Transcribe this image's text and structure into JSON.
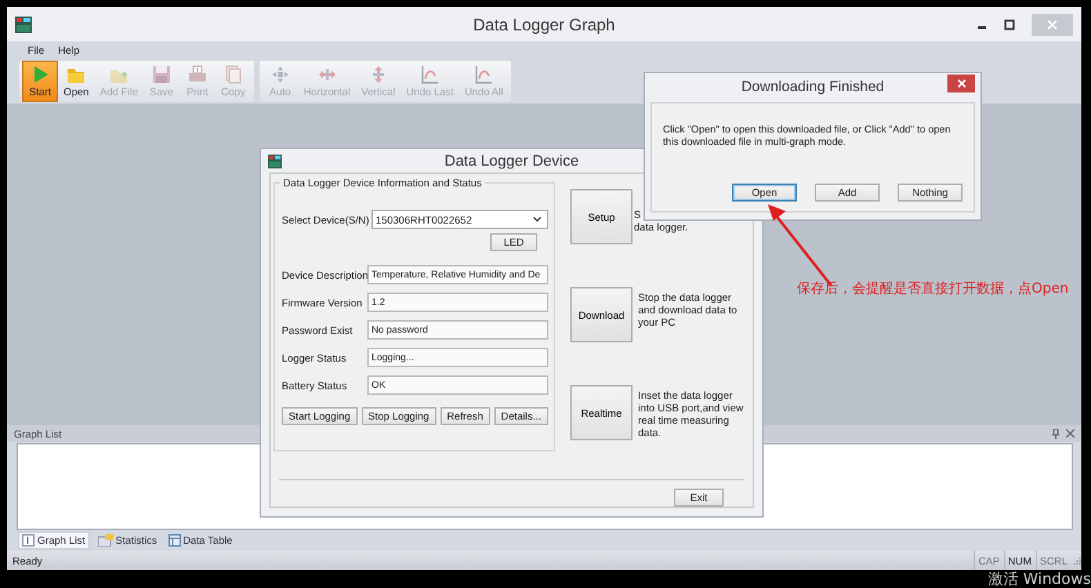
{
  "window": {
    "title": "Data Logger Graph"
  },
  "menu": [
    "File",
    "Help"
  ],
  "toolbar_groups": [
    [
      {
        "label": "Start",
        "kind": "start",
        "selected": true,
        "disabled": false
      },
      {
        "label": "Open",
        "kind": "open",
        "selected": false,
        "disabled": false
      },
      {
        "label": "Add File",
        "kind": "add",
        "selected": false,
        "disabled": true
      },
      {
        "label": "Save",
        "kind": "save",
        "selected": false,
        "disabled": true
      },
      {
        "label": "Print",
        "kind": "print",
        "selected": false,
        "disabled": true
      },
      {
        "label": "Copy",
        "kind": "copy",
        "selected": false,
        "disabled": true
      }
    ],
    [
      {
        "label": "Auto",
        "kind": "auto",
        "selected": false,
        "disabled": true
      },
      {
        "label": "Horizontal",
        "kind": "horizontal",
        "selected": false,
        "disabled": true
      },
      {
        "label": "Vertical",
        "kind": "vertical",
        "selected": false,
        "disabled": true
      },
      {
        "label": "Undo Last",
        "kind": "undo",
        "selected": false,
        "disabled": true
      },
      {
        "label": "Undo All",
        "kind": "undo",
        "selected": false,
        "disabled": true
      }
    ]
  ],
  "graph_list_panel": {
    "title": "Graph List"
  },
  "bottom_tabs": [
    {
      "label": "Graph List",
      "kind": "list",
      "selected": true
    },
    {
      "label": "Statistics",
      "kind": "stats",
      "selected": false
    },
    {
      "label": "Data Table",
      "kind": "table",
      "selected": false
    }
  ],
  "status_bar": {
    "text": "Ready",
    "indicators": [
      {
        "label": "CAP",
        "on": false
      },
      {
        "label": "NUM",
        "on": true
      },
      {
        "label": "SCRL",
        "on": false
      }
    ]
  },
  "device_dialog": {
    "title": "Data Logger Device",
    "group_title": "Data Logger Device Information and Status",
    "select_label": "Select Device(S/N)",
    "select_value": "150306RHT0022652",
    "led_button": "LED",
    "fields": [
      {
        "label": "Device Description",
        "value": "Temperature, Relative Humidity and De"
      },
      {
        "label": "Firmware Version",
        "value": "1.2"
      },
      {
        "label": "Password Exist",
        "value": "No password"
      },
      {
        "label": "Logger Status",
        "value": "Logging..."
      },
      {
        "label": "Battery Status",
        "value": "OK"
      }
    ],
    "buttons": [
      "Start Logging",
      "Stop Logging",
      "Refresh",
      "Details..."
    ],
    "actions": [
      {
        "label": "Setup",
        "description": [
          "S",
          "data logger."
        ]
      },
      {
        "label": "Download",
        "description": [
          "Stop the data logger",
          "and download data to",
          "your PC"
        ]
      },
      {
        "label": "Realtime",
        "description": [
          "Inset the data logger",
          "into USB port,and view",
          "real time measuring",
          "data."
        ]
      }
    ],
    "exit_button": "Exit"
  },
  "finished_dialog": {
    "title": "Downloading Finished",
    "message": "Click \"Open\" to open this downloaded file, or Click \"Add\" to open this downloaded file in multi-graph mode.",
    "buttons": [
      {
        "label": "Open",
        "selected": true
      },
      {
        "label": "Add",
        "selected": false
      },
      {
        "label": "Nothing",
        "selected": false
      }
    ]
  },
  "annotation": {
    "text": "保存后，会提醒是否直接打开数据，点Open"
  },
  "activation_notice": "激活 Windows"
}
